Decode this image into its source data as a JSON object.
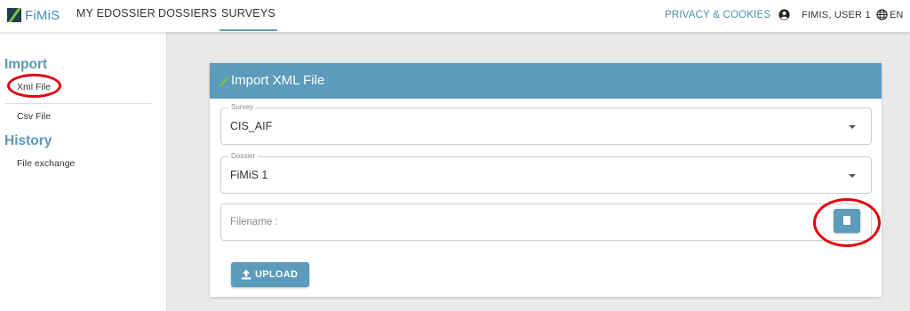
{
  "app": {
    "logo_text": "FiMiS"
  },
  "nav": {
    "links": [
      {
        "label": "MY EDOSSIER"
      },
      {
        "label": "DOSSIERS"
      },
      {
        "label": "SURVEYS",
        "active": true
      }
    ],
    "privacy": "PRIVACY & COOKIES",
    "user": "FIMIS, USER 1",
    "lang": "EN"
  },
  "sidebar": {
    "import_heading": "Import",
    "import_items": [
      {
        "label": "Xml File"
      },
      {
        "label": "Csv File"
      }
    ],
    "history_heading": "History",
    "history_items": [
      {
        "label": "File exchange"
      }
    ]
  },
  "card": {
    "title": "Import XML File",
    "survey": {
      "legend": "Survey",
      "value": "CIS_AIF"
    },
    "dossier": {
      "legend": "Dossier",
      "value": "FiMiS 1"
    },
    "filename_label": "Filename :",
    "upload_label": "UPLOAD"
  },
  "colors": {
    "accent": "#5b9bbc",
    "heading": "#5b98bb",
    "annotation": "#e3000f",
    "logo_green": "#7ac143"
  },
  "icons": {
    "user": "user-circle-icon",
    "lang": "globe-icon",
    "header": "pencil-icon",
    "file": "file-icon",
    "upload": "upload-icon",
    "select": "caret-down-icon"
  }
}
